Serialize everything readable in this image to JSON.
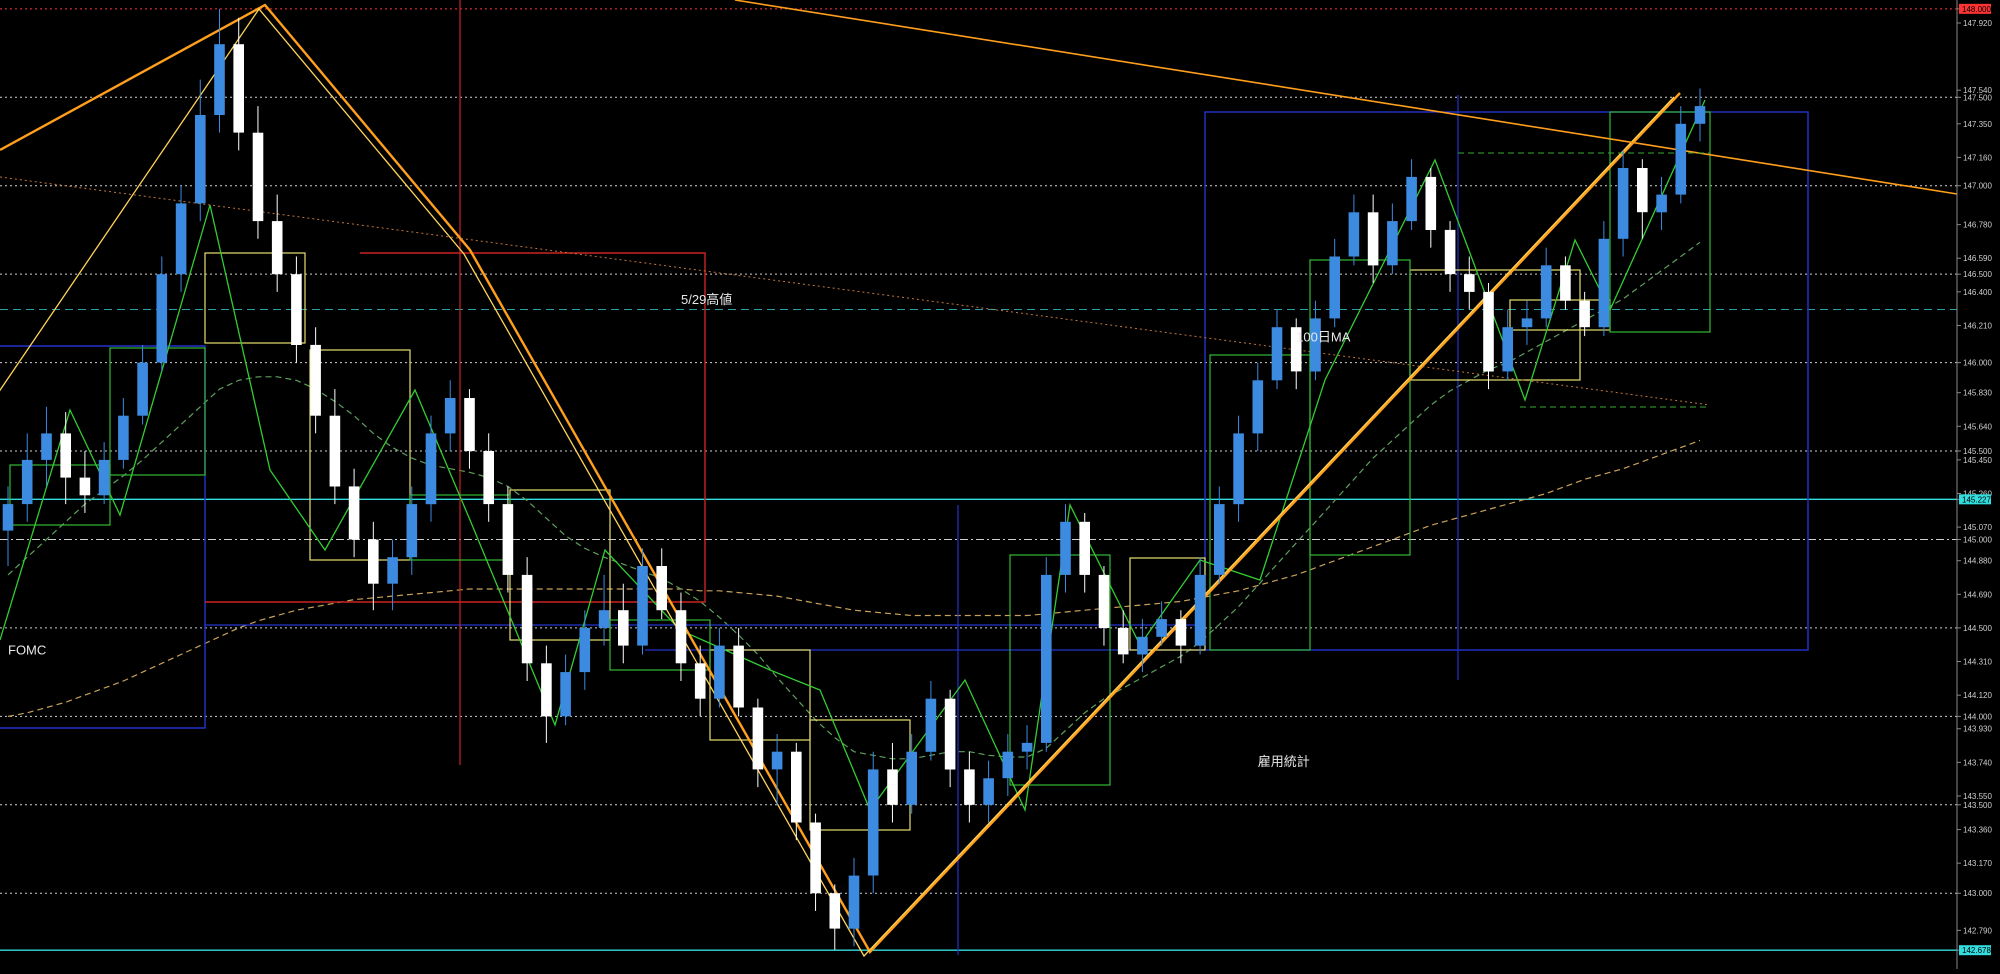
{
  "chart_data": {
    "type": "candlestick",
    "instrument": "",
    "title": "",
    "ylim": [
      142.6,
      148.05
    ],
    "grid": true,
    "price_axis": {
      "tick_labels": [
        "148.000",
        "147.920",
        "147.540",
        "147.500",
        "147.350",
        "147.160",
        "147.000",
        "146.780",
        "146.590",
        "146.500",
        "146.400",
        "146.210",
        "146.000",
        "145.830",
        "145.640",
        "145.500",
        "145.450",
        "145.260",
        "145.227",
        "145.070",
        "145.000",
        "144.880",
        "144.690",
        "144.500",
        "144.310",
        "144.120",
        "144.000",
        "143.930",
        "143.740",
        "143.550",
        "143.500",
        "143.360",
        "143.170",
        "143.000",
        "142.790",
        "142.678"
      ],
      "highlighted": [
        {
          "label": "148.000",
          "value": 148.0,
          "color": "#ff3333"
        },
        {
          "label": "145.227",
          "value": 145.227,
          "color": "#33dddd"
        },
        {
          "label": "142.678",
          "value": 142.678,
          "color": "#33dddd"
        }
      ]
    },
    "horizontal_levels": [
      {
        "value": 148.0,
        "style": "dotted",
        "color": "#ff3333"
      },
      {
        "value": 147.5,
        "style": "dotted",
        "color": "#cfcfcf"
      },
      {
        "value": 147.0,
        "style": "dotted",
        "color": "#cfcfcf"
      },
      {
        "value": 146.5,
        "style": "dotted",
        "color": "#cfcfcf"
      },
      {
        "value": 146.3,
        "style": "dashed",
        "color": "#2a9fa8"
      },
      {
        "value": 146.0,
        "style": "dotted",
        "color": "#cfcfcf"
      },
      {
        "value": 145.5,
        "style": "dotted",
        "color": "#cfcfcf"
      },
      {
        "value": 145.227,
        "style": "solid",
        "color": "#33dddd"
      },
      {
        "value": 145.0,
        "style": "dashdot",
        "color": "#cfcfcf"
      },
      {
        "value": 144.5,
        "style": "dotted",
        "color": "#cfcfcf"
      },
      {
        "value": 144.0,
        "style": "dotted",
        "color": "#cfcfcf"
      },
      {
        "value": 143.5,
        "style": "dotted",
        "color": "#cfcfcf"
      },
      {
        "value": 143.0,
        "style": "dotted",
        "color": "#cfcfcf"
      },
      {
        "value": 142.678,
        "style": "solid",
        "color": "#33dddd"
      }
    ],
    "annotations": [
      {
        "text": "5/29高値",
        "x_index": 35,
        "y": 146.33
      },
      {
        "text": "100日MA",
        "x_index": 67,
        "y": 146.12
      },
      {
        "text": "FOMC",
        "x_index": 0,
        "y": 144.35
      },
      {
        "text": "雇用統計",
        "x_index": 65,
        "y": 143.72
      }
    ],
    "candles": [
      {
        "o": 145.05,
        "h": 145.3,
        "l": 144.85,
        "c": 145.2
      },
      {
        "o": 145.2,
        "h": 145.6,
        "l": 145.1,
        "c": 145.45
      },
      {
        "o": 145.45,
        "h": 145.75,
        "l": 145.3,
        "c": 145.6
      },
      {
        "o": 145.6,
        "h": 145.72,
        "l": 145.2,
        "c": 145.35
      },
      {
        "o": 145.35,
        "h": 145.5,
        "l": 145.15,
        "c": 145.25
      },
      {
        "o": 145.25,
        "h": 145.55,
        "l": 145.2,
        "c": 145.45
      },
      {
        "o": 145.45,
        "h": 145.8,
        "l": 145.4,
        "c": 145.7
      },
      {
        "o": 145.7,
        "h": 146.1,
        "l": 145.65,
        "c": 146.0
      },
      {
        "o": 146.0,
        "h": 146.6,
        "l": 145.95,
        "c": 146.5
      },
      {
        "o": 146.5,
        "h": 147.0,
        "l": 146.4,
        "c": 146.9
      },
      {
        "o": 146.9,
        "h": 147.6,
        "l": 146.8,
        "c": 147.4
      },
      {
        "o": 147.4,
        "h": 148.0,
        "l": 147.3,
        "c": 147.8
      },
      {
        "o": 147.8,
        "h": 147.95,
        "l": 147.2,
        "c": 147.3
      },
      {
        "o": 147.3,
        "h": 147.45,
        "l": 146.7,
        "c": 146.8
      },
      {
        "o": 146.8,
        "h": 146.95,
        "l": 146.4,
        "c": 146.5
      },
      {
        "o": 146.5,
        "h": 146.6,
        "l": 146.0,
        "c": 146.1
      },
      {
        "o": 146.1,
        "h": 146.2,
        "l": 145.6,
        "c": 145.7
      },
      {
        "o": 145.7,
        "h": 145.85,
        "l": 145.2,
        "c": 145.3
      },
      {
        "o": 145.3,
        "h": 145.4,
        "l": 144.9,
        "c": 145.0
      },
      {
        "o": 145.0,
        "h": 145.1,
        "l": 144.6,
        "c": 144.75
      },
      {
        "o": 144.75,
        "h": 145.0,
        "l": 144.6,
        "c": 144.9
      },
      {
        "o": 144.9,
        "h": 145.3,
        "l": 144.8,
        "c": 145.2
      },
      {
        "o": 145.2,
        "h": 145.7,
        "l": 145.1,
        "c": 145.6
      },
      {
        "o": 145.6,
        "h": 145.9,
        "l": 145.5,
        "c": 145.8
      },
      {
        "o": 145.8,
        "h": 145.85,
        "l": 145.4,
        "c": 145.5
      },
      {
        "o": 145.5,
        "h": 145.6,
        "l": 145.1,
        "c": 145.2
      },
      {
        "o": 145.2,
        "h": 145.3,
        "l": 144.7,
        "c": 144.8
      },
      {
        "o": 144.8,
        "h": 144.9,
        "l": 144.2,
        "c": 144.3
      },
      {
        "o": 144.3,
        "h": 144.4,
        "l": 143.85,
        "c": 144.0
      },
      {
        "o": 144.0,
        "h": 144.35,
        "l": 143.95,
        "c": 144.25
      },
      {
        "o": 144.25,
        "h": 144.6,
        "l": 144.15,
        "c": 144.5
      },
      {
        "o": 144.5,
        "h": 144.8,
        "l": 144.4,
        "c": 144.6
      },
      {
        "o": 144.6,
        "h": 144.75,
        "l": 144.3,
        "c": 144.4
      },
      {
        "o": 144.4,
        "h": 144.95,
        "l": 144.35,
        "c": 144.85
      },
      {
        "o": 144.85,
        "h": 144.95,
        "l": 144.55,
        "c": 144.6
      },
      {
        "o": 144.6,
        "h": 144.7,
        "l": 144.2,
        "c": 144.3
      },
      {
        "o": 144.3,
        "h": 144.4,
        "l": 144.0,
        "c": 144.1
      },
      {
        "o": 144.1,
        "h": 144.5,
        "l": 144.05,
        "c": 144.4
      },
      {
        "o": 144.4,
        "h": 144.5,
        "l": 144.0,
        "c": 144.05
      },
      {
        "o": 144.05,
        "h": 144.1,
        "l": 143.6,
        "c": 143.7
      },
      {
        "o": 143.7,
        "h": 143.9,
        "l": 143.5,
        "c": 143.8
      },
      {
        "o": 143.8,
        "h": 143.85,
        "l": 143.3,
        "c": 143.4
      },
      {
        "o": 143.4,
        "h": 143.45,
        "l": 142.9,
        "c": 143.0
      },
      {
        "o": 143.0,
        "h": 143.05,
        "l": 142.68,
        "c": 142.8
      },
      {
        "o": 142.8,
        "h": 143.2,
        "l": 142.7,
        "c": 143.1
      },
      {
        "o": 143.1,
        "h": 143.8,
        "l": 143.0,
        "c": 143.7
      },
      {
        "o": 143.7,
        "h": 143.85,
        "l": 143.4,
        "c": 143.5
      },
      {
        "o": 143.5,
        "h": 143.9,
        "l": 143.45,
        "c": 143.8
      },
      {
        "o": 143.8,
        "h": 144.2,
        "l": 143.75,
        "c": 144.1
      },
      {
        "o": 144.1,
        "h": 144.15,
        "l": 143.6,
        "c": 143.7
      },
      {
        "o": 143.7,
        "h": 143.8,
        "l": 143.4,
        "c": 143.5
      },
      {
        "o": 143.5,
        "h": 143.75,
        "l": 143.4,
        "c": 143.65
      },
      {
        "o": 143.65,
        "h": 143.9,
        "l": 143.55,
        "c": 143.8
      },
      {
        "o": 143.8,
        "h": 143.95,
        "l": 143.7,
        "c": 143.85
      },
      {
        "o": 143.85,
        "h": 144.9,
        "l": 143.8,
        "c": 144.8
      },
      {
        "o": 144.8,
        "h": 145.2,
        "l": 144.7,
        "c": 145.1
      },
      {
        "o": 145.1,
        "h": 145.15,
        "l": 144.7,
        "c": 144.8
      },
      {
        "o": 144.8,
        "h": 144.85,
        "l": 144.4,
        "c": 144.5
      },
      {
        "o": 144.5,
        "h": 144.6,
        "l": 144.3,
        "c": 144.35
      },
      {
        "o": 144.35,
        "h": 144.55,
        "l": 144.25,
        "c": 144.45
      },
      {
        "o": 144.45,
        "h": 144.65,
        "l": 144.4,
        "c": 144.55
      },
      {
        "o": 144.55,
        "h": 144.6,
        "l": 144.3,
        "c": 144.4
      },
      {
        "o": 144.4,
        "h": 144.9,
        "l": 144.35,
        "c": 144.8
      },
      {
        "o": 144.8,
        "h": 145.3,
        "l": 144.75,
        "c": 145.2
      },
      {
        "o": 145.2,
        "h": 145.7,
        "l": 145.1,
        "c": 145.6
      },
      {
        "o": 145.6,
        "h": 146.0,
        "l": 145.5,
        "c": 145.9
      },
      {
        "o": 145.9,
        "h": 146.3,
        "l": 145.85,
        "c": 146.2
      },
      {
        "o": 146.2,
        "h": 146.25,
        "l": 145.85,
        "c": 145.95
      },
      {
        "o": 145.95,
        "h": 146.35,
        "l": 145.9,
        "c": 146.25
      },
      {
        "o": 146.25,
        "h": 146.7,
        "l": 146.2,
        "c": 146.6
      },
      {
        "o": 146.6,
        "h": 146.95,
        "l": 146.55,
        "c": 146.85
      },
      {
        "o": 146.85,
        "h": 146.95,
        "l": 146.45,
        "c": 146.55
      },
      {
        "o": 146.55,
        "h": 146.9,
        "l": 146.5,
        "c": 146.8
      },
      {
        "o": 146.8,
        "h": 147.15,
        "l": 146.75,
        "c": 147.05
      },
      {
        "o": 147.05,
        "h": 147.1,
        "l": 146.65,
        "c": 146.75
      },
      {
        "o": 146.75,
        "h": 146.8,
        "l": 146.4,
        "c": 146.5
      },
      {
        "o": 146.5,
        "h": 146.6,
        "l": 146.3,
        "c": 146.4
      },
      {
        "o": 146.4,
        "h": 146.45,
        "l": 145.85,
        "c": 145.95
      },
      {
        "o": 145.95,
        "h": 146.3,
        "l": 145.9,
        "c": 146.2
      },
      {
        "o": 146.2,
        "h": 146.35,
        "l": 146.1,
        "c": 146.25
      },
      {
        "o": 146.25,
        "h": 146.65,
        "l": 146.2,
        "c": 146.55
      },
      {
        "o": 146.55,
        "h": 146.6,
        "l": 146.3,
        "c": 146.35
      },
      {
        "o": 146.35,
        "h": 146.4,
        "l": 146.15,
        "c": 146.2
      },
      {
        "o": 146.2,
        "h": 146.8,
        "l": 146.15,
        "c": 146.7
      },
      {
        "o": 146.7,
        "h": 147.2,
        "l": 146.6,
        "c": 147.1
      },
      {
        "o": 147.1,
        "h": 147.15,
        "l": 146.7,
        "c": 146.85
      },
      {
        "o": 146.85,
        "h": 147.05,
        "l": 146.75,
        "c": 146.95
      },
      {
        "o": 146.95,
        "h": 147.45,
        "l": 146.9,
        "c": 147.35
      },
      {
        "o": 147.35,
        "h": 147.55,
        "l": 147.25,
        "c": 147.45
      }
    ],
    "moving_averages": [
      {
        "name": "",
        "color": "#c8a25a",
        "style": "dashed",
        "values": [
          144.0,
          144.02,
          144.05,
          144.08,
          144.12,
          144.16,
          144.2,
          144.25,
          144.3,
          144.35,
          144.4,
          144.45,
          144.5,
          144.54,
          144.57,
          144.6,
          144.62,
          144.64,
          144.66,
          144.67,
          144.68,
          144.69,
          144.7,
          144.71,
          144.72,
          144.72,
          144.72,
          144.72,
          144.72,
          144.72,
          144.72,
          144.72,
          144.72,
          144.72,
          144.72,
          144.72,
          144.71,
          144.71,
          144.7,
          144.69,
          144.68,
          144.66,
          144.64,
          144.62,
          144.6,
          144.59,
          144.58,
          144.57,
          144.57,
          144.57,
          144.57,
          144.57,
          144.57,
          144.57,
          144.58,
          144.59,
          144.6,
          144.61,
          144.62,
          144.63,
          144.64,
          144.65,
          144.67,
          144.69,
          144.71,
          144.74,
          144.77,
          144.8,
          144.84,
          144.88,
          144.92,
          144.96,
          145.0,
          145.04,
          145.08,
          145.11,
          145.14,
          145.17,
          145.2,
          145.23,
          145.26,
          145.3,
          145.34,
          145.37,
          145.4,
          145.44,
          145.48,
          145.52,
          145.56
        ]
      },
      {
        "name": "",
        "color": "#5ea05e",
        "style": "dashed",
        "values": [
          144.8,
          144.9,
          145.0,
          145.1,
          145.2,
          145.28,
          145.36,
          145.45,
          145.55,
          145.65,
          145.75,
          145.85,
          145.9,
          145.92,
          145.92,
          145.9,
          145.85,
          145.78,
          145.7,
          145.6,
          145.52,
          145.46,
          145.42,
          145.4,
          145.38,
          145.35,
          145.3,
          145.22,
          145.12,
          145.02,
          144.95,
          144.9,
          144.86,
          144.82,
          144.78,
          144.72,
          144.65,
          144.56,
          144.46,
          144.35,
          144.22,
          144.1,
          143.98,
          143.88,
          143.8,
          143.78,
          143.76,
          143.76,
          143.78,
          143.8,
          143.8,
          143.78,
          143.77,
          143.77,
          143.82,
          143.92,
          144.02,
          144.1,
          144.16,
          144.22,
          144.28,
          144.34,
          144.42,
          144.52,
          144.62,
          144.74,
          144.86,
          144.98,
          145.1,
          145.22,
          145.34,
          145.46,
          145.56,
          145.66,
          145.76,
          145.84,
          145.9,
          145.96,
          146.0,
          146.06,
          146.12,
          146.18,
          146.24,
          146.3,
          146.36,
          146.44,
          146.52,
          146.6,
          146.68
        ]
      }
    ]
  }
}
